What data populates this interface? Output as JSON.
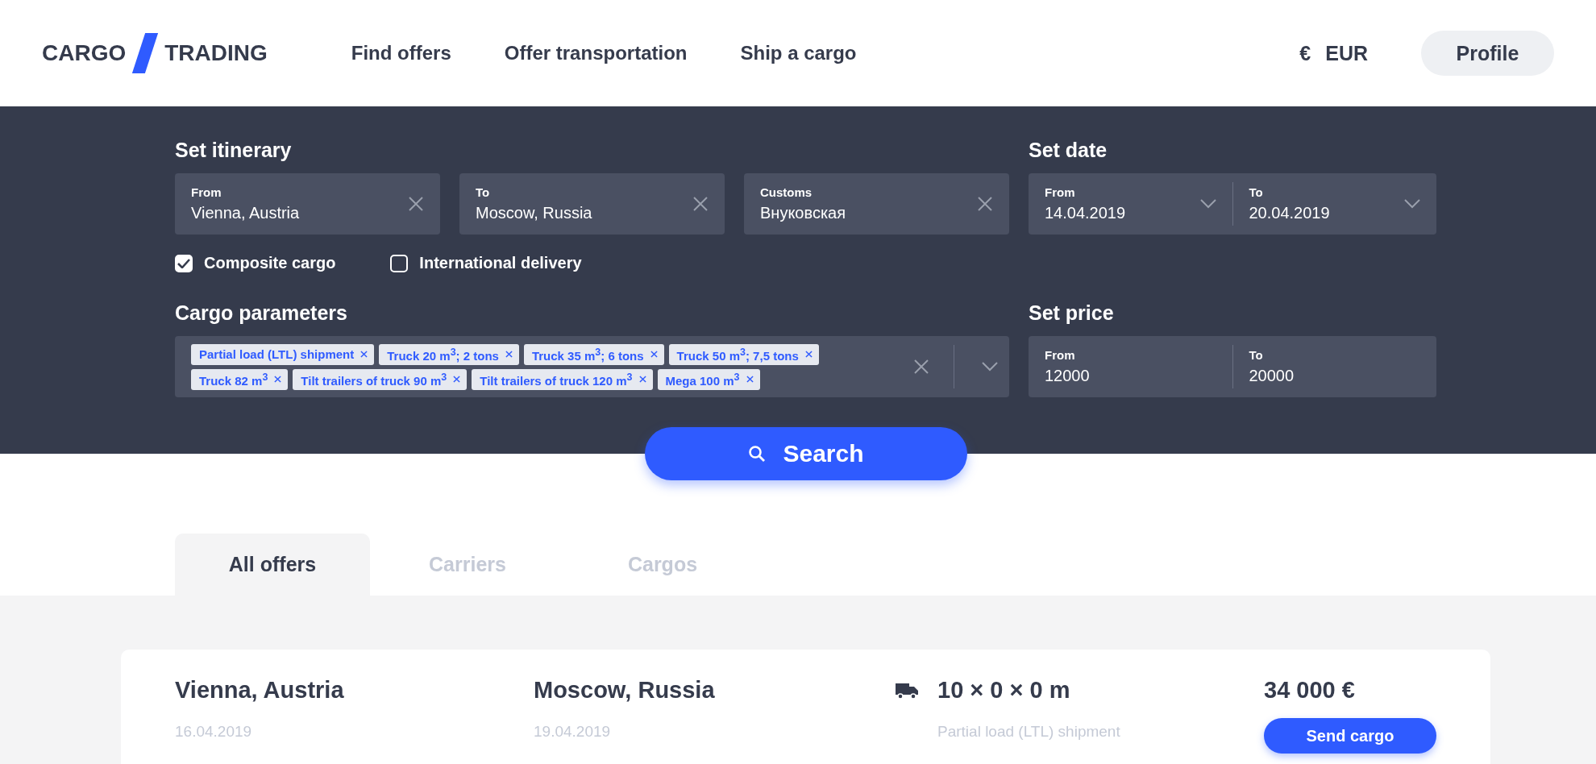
{
  "header": {
    "logo_left": "CARGO",
    "logo_right": "TRADING",
    "nav": [
      {
        "label": "Find offers"
      },
      {
        "label": "Offer transportation"
      },
      {
        "label": "Ship a cargo"
      }
    ],
    "currency_symbol": "€",
    "currency": "EUR",
    "profile": "Profile"
  },
  "filters": {
    "itinerary_title": "Set itinerary",
    "itinerary": [
      {
        "label": "From",
        "value": "Vienna, Austria"
      },
      {
        "label": "To",
        "value": "Moscow, Russia"
      },
      {
        "label": "Customs",
        "value": "Внуковская"
      }
    ],
    "date_title": "Set date",
    "dates": [
      {
        "label": "From",
        "value": "14.04.2019"
      },
      {
        "label": "To",
        "value": "20.04.2019"
      }
    ],
    "options": [
      {
        "label": "Composite cargo",
        "checked": true
      },
      {
        "label": "International delivery",
        "checked": false
      }
    ],
    "cargo_title": "Cargo parameters",
    "tags": [
      "Partial load (LTL) shipment",
      "Truck 20 m$^{3}$; 2 tons",
      "Truck 35 m$^{3}$; 6 tons",
      "Truck 50 m$^{3}$; 7,5 tons",
      "Truck 82 m$^{3}$",
      "Tilt trailers of truck 90 m$^{3}$",
      "Tilt trailers of truck 120 m$^{3}$",
      "Mega 100 m$^{3}$"
    ],
    "price_title": "Set price",
    "prices": [
      {
        "label": "From",
        "value": "12000"
      },
      {
        "label": "To",
        "value": "20000"
      }
    ],
    "search": "Search"
  },
  "tabs": [
    {
      "label": "All offers",
      "selected": true
    },
    {
      "label": "Carriers",
      "selected": false
    },
    {
      "label": "Cargos",
      "selected": false
    }
  ],
  "offers": [
    {
      "from": "Vienna, Austria",
      "from_date": "16.04.2019",
      "to": "Moscow, Russia",
      "to_date": "19.04.2019",
      "size": "10 × 0 × 0 m",
      "load": "Partial load (LTL) shipment",
      "price": "34 000 €",
      "action": "Send cargo"
    }
  ]
}
